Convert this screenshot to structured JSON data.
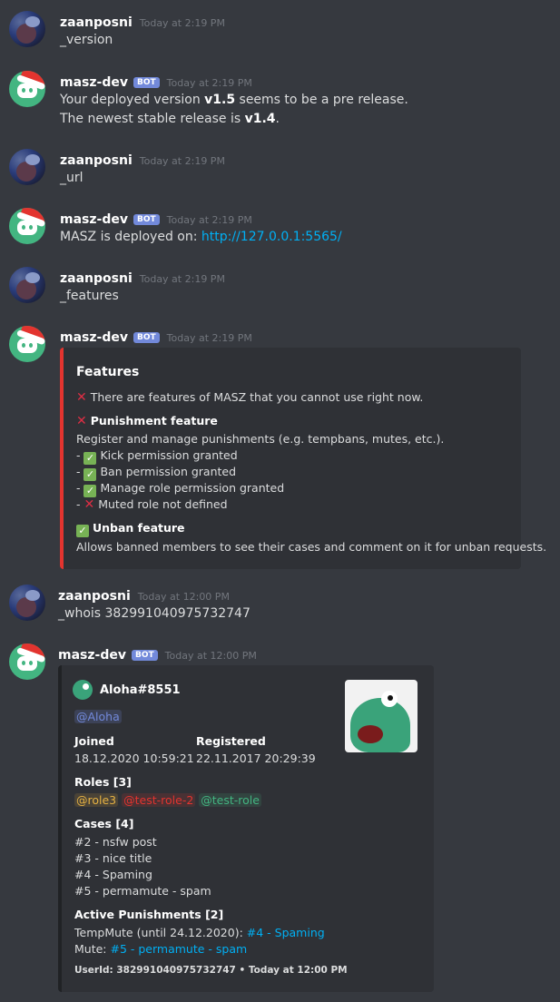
{
  "messages": [
    {
      "author": "zaanposni",
      "time": "Today at 2:19 PM",
      "text": "_version"
    },
    {
      "author": "masz-dev",
      "bot": "BOT",
      "time": "Today at 2:19 PM",
      "line1_pre": "Your deployed version ",
      "line1_bold": "v1.5",
      "line1_post": " seems to be a pre release.",
      "line2_pre": "The newest stable release is ",
      "line2_bold": "v1.4",
      "line2_post": "."
    },
    {
      "author": "zaanposni",
      "time": "Today at 2:19 PM",
      "text": "_url"
    },
    {
      "author": "masz-dev",
      "bot": "BOT",
      "time": "Today at 2:19 PM",
      "text_pre": "MASZ is deployed on: ",
      "link": "http://127.0.0.1:5565/"
    },
    {
      "author": "zaanposni",
      "time": "Today at 2:19 PM",
      "text": "_features"
    },
    {
      "author": "masz-dev",
      "bot": "BOT",
      "time": "Today at 2:19 PM"
    },
    {
      "author": "zaanposni",
      "time": "Today at 12:00 PM",
      "text": "_whois 382991040975732747"
    },
    {
      "author": "masz-dev",
      "bot": "BOT",
      "time": "Today at 12:00 PM"
    }
  ],
  "features_embed": {
    "title": "Features",
    "warning": "There are features of MASZ that you cannot use right now.",
    "punishment_title": "Punishment feature",
    "punishment_desc": "Register and manage punishments (e.g. tempbans, mutes, etc.).",
    "checks": [
      {
        "status": "ok",
        "text": "Kick permission granted"
      },
      {
        "status": "ok",
        "text": "Ban permission granted"
      },
      {
        "status": "ok",
        "text": "Manage role permission granted"
      },
      {
        "status": "fail",
        "text": "Muted role not defined"
      }
    ],
    "unban_title": "Unban feature",
    "unban_desc": "Allows banned members to see their cases and comment on it for unban requests.",
    "accent_color": "#e3342f"
  },
  "whois_embed": {
    "author": "Aloha#8551",
    "mention": "@Aloha",
    "joined_label": "Joined",
    "joined_value": "18.12.2020 10:59:21",
    "registered_label": "Registered",
    "registered_value": "22.11.2017 20:29:39",
    "roles_label": "Roles [3]",
    "roles": [
      "@role3",
      "@test-role-2",
      "@test-role"
    ],
    "cases_label": "Cases [4]",
    "cases": [
      "#2 - nsfw post",
      "#3 - nice title",
      "#4 - Spaming",
      "#5 - permamute - spam"
    ],
    "punishments_label": "Active Punishments [2]",
    "p1_pre": "TempMute (until 24.12.2020): ",
    "p1_link": "#4 - Spaming",
    "p2_pre": "Mute: ",
    "p2_link": "#5 - permamute - spam",
    "footer": "UserId: 382991040975732747 • Today at 12:00 PM"
  }
}
